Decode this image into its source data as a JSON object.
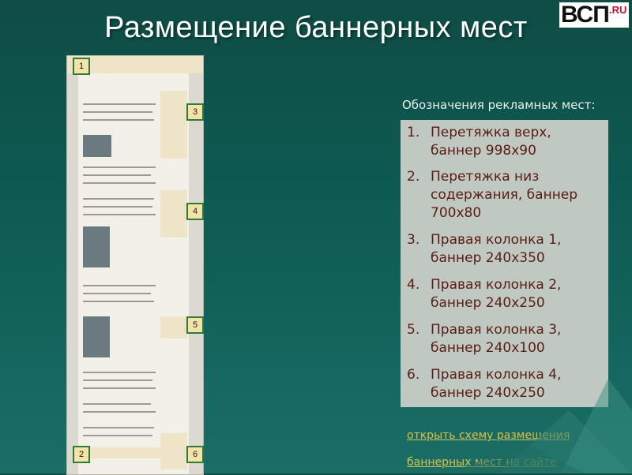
{
  "slide": {
    "title": "Размещение баннерных мест",
    "logo_text": "ВСП",
    "logo_suffix": ".RU"
  },
  "markers": [
    "1",
    "3",
    "4",
    "5",
    "2",
    "6"
  ],
  "legend": {
    "heading": "Обозначения рекламных мест:",
    "items": [
      {
        "num": "1.",
        "text": "Перетяжка верх, баннер 998х90"
      },
      {
        "num": "2.",
        "text": "Перетяжка низ содержания, баннер 700х80"
      },
      {
        "num": "3.",
        "text": "Правая колонка 1, баннер 240х350"
      },
      {
        "num": "4.",
        "text": "Правая колонка 2, баннер 240х250"
      },
      {
        "num": "5.",
        "text": "Правая колонка 3, баннер 240х100"
      },
      {
        "num": "6.",
        "text": "Правая колонка 4, баннер 240х250"
      }
    ]
  },
  "link": {
    "line1": "открыть схему размещения",
    "line2": "баннерных мест на сайте"
  },
  "colors": {
    "background": "#0d5a52",
    "title": "#ffffff",
    "legend_box": "#bfc8c1",
    "legend_text": "#5a1c14",
    "link": "#d8c14a"
  }
}
